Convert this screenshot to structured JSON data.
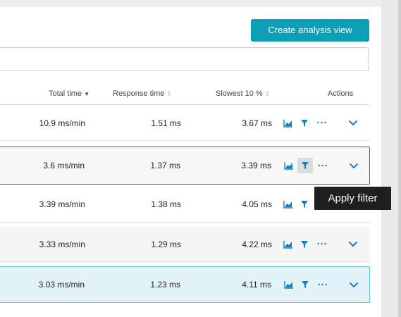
{
  "toolbar": {
    "create_label": "Create analysis view",
    "accent_color": "#0a9fb4"
  },
  "filter": {
    "placeholder": ""
  },
  "table": {
    "headers": {
      "total_time": "Total time",
      "total_time_sort": "▼",
      "response_time": "Response time",
      "response_time_sort": "⇕",
      "slowest": "Slowest 10 %",
      "slowest_sort": "⇕",
      "actions": "Actions"
    },
    "rows": [
      {
        "total_time": "10.9 ms/min",
        "response_time": "1.51 ms",
        "slowest": "3.67 ms",
        "state": "normal"
      },
      {
        "total_time": "3.6 ms/min",
        "response_time": "1.37 ms",
        "slowest": "3.39 ms",
        "state": "hovered"
      },
      {
        "total_time": "3.39 ms/min",
        "response_time": "1.38 ms",
        "slowest": "4.05 ms",
        "state": "normal"
      },
      {
        "total_time": "3.33 ms/min",
        "response_time": "1.29 ms",
        "slowest": "4.22 ms",
        "state": "alternate"
      },
      {
        "total_time": "3.03 ms/min",
        "response_time": "1.23 ms",
        "slowest": "4.11 ms",
        "state": "selected"
      }
    ],
    "action_icons": [
      "chart-icon",
      "filter-icon",
      "more-icon",
      "expand-icon"
    ],
    "more_glyph": "···"
  },
  "tooltip": {
    "text": "Apply filter"
  }
}
